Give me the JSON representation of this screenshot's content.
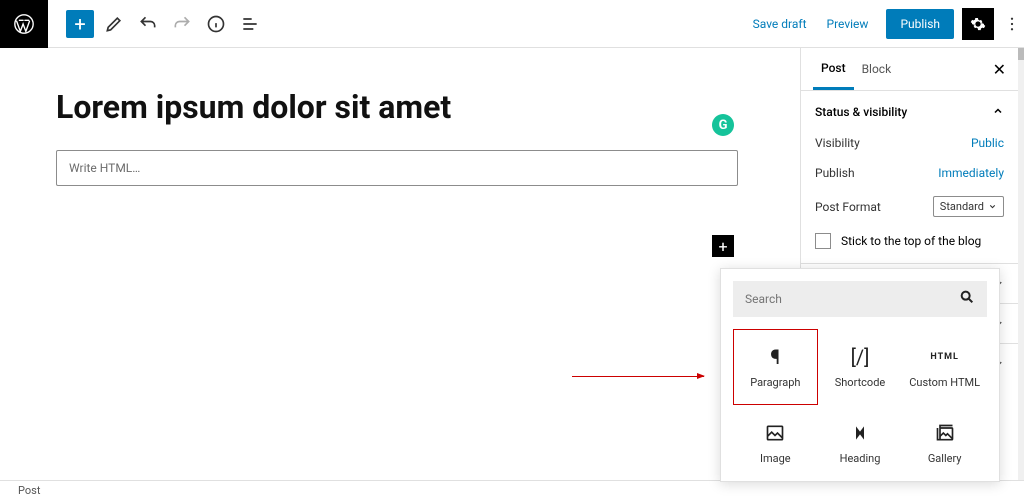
{
  "toolbar": {
    "save_draft": "Save draft",
    "preview": "Preview",
    "publish": "Publish"
  },
  "post": {
    "title": "Lorem ipsum dolor sit amet",
    "html_placeholder": "Write HTML…"
  },
  "sidebar": {
    "tab_post": "Post",
    "tab_block": "Block",
    "panel_status": "Status & visibility",
    "visibility_label": "Visibility",
    "visibility_value": "Public",
    "publish_label": "Publish",
    "publish_value": "Immediately",
    "format_label": "Post Format",
    "format_value": "Standard",
    "stick_label": "Stick to the top of the blog"
  },
  "inserter": {
    "search_placeholder": "Search",
    "blocks": {
      "paragraph": "Paragraph",
      "shortcode": "Shortcode",
      "custom_html": "Custom HTML",
      "image": "Image",
      "heading": "Heading",
      "gallery": "Gallery"
    }
  },
  "footer": {
    "breadcrumb": "Post"
  },
  "icons": {
    "html_label": "HTML"
  }
}
